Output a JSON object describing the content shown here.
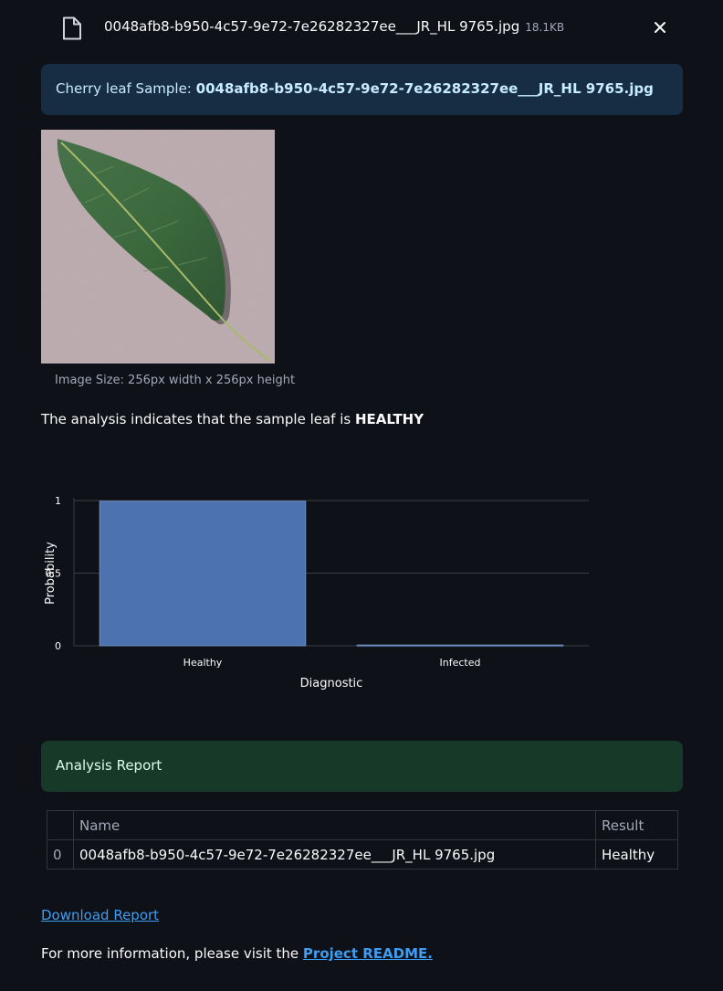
{
  "file": {
    "name": "0048afb8-b950-4c57-9e72-7e26282327ee___JR_HL 9765.jpg",
    "size": "18.1KB",
    "icon": "file-icon",
    "close_icon": "close-icon"
  },
  "info": {
    "prefix": "Cherry leaf Sample: ",
    "filename": "0048afb8-b950-4c57-9e72-7e26282327ee___JR_HL 9765.jpg"
  },
  "image": {
    "caption": "Image Size: 256px width x 256px height"
  },
  "analysis": {
    "prefix": "The analysis indicates that the sample leaf is ",
    "result": "HEALTHY"
  },
  "chart_data": {
    "type": "bar",
    "categories": [
      "Healthy",
      "Infected"
    ],
    "values": [
      0.995,
      0.005
    ],
    "xlabel": "Diagnostic",
    "ylabel": "Probability",
    "ylim": [
      0,
      1
    ],
    "yticks": [
      "0",
      "0.5",
      "1"
    ],
    "bar_color": "#4c72b0",
    "grid": true
  },
  "report": {
    "title": "Analysis Report",
    "columns": [
      "",
      "Name",
      "Result"
    ],
    "rows": [
      [
        "0",
        "0048afb8-b950-4c57-9e72-7e26282327ee___JR_HL 9765.jpg",
        "Healthy"
      ]
    ]
  },
  "links": {
    "download": "Download Report",
    "more_info_prefix": "For more information, please visit the ",
    "readme": "Project README."
  },
  "colors": {
    "background": "#0e1117",
    "info_bg": "#172d43",
    "success_bg": "#173928",
    "link": "#3d9df3"
  }
}
